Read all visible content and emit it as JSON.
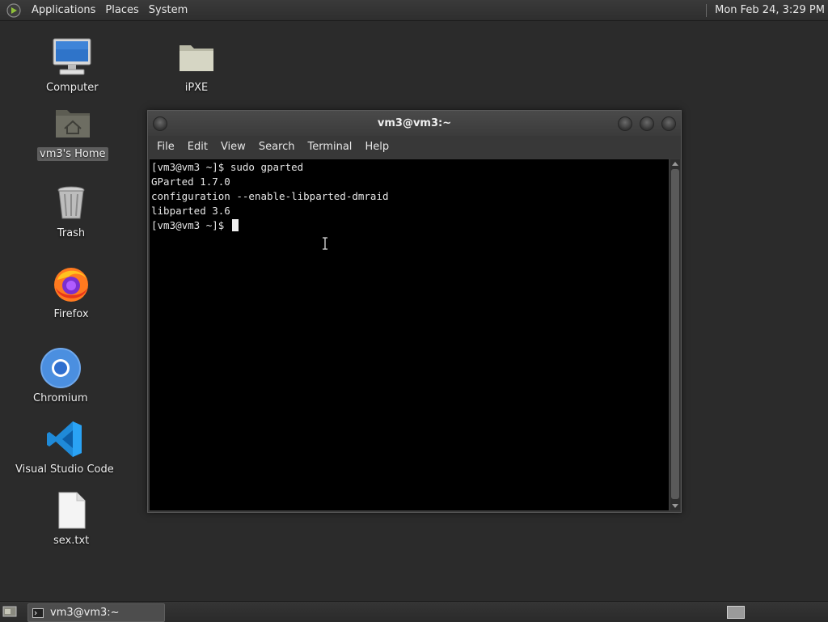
{
  "top_panel": {
    "menus": [
      "Applications",
      "Places",
      "System"
    ],
    "clock": "Mon Feb 24,  3:29 PM"
  },
  "desktop": {
    "icons": {
      "computer": "Computer",
      "ipxe": "iPXE",
      "home": "vm3's Home",
      "trash": "Trash",
      "firefox": "Firefox",
      "chromium": "Chromium",
      "vscode": "Visual Studio Code",
      "textfile": "sex.txt"
    }
  },
  "terminal": {
    "title": "vm3@vm3:~",
    "menu": [
      "File",
      "Edit",
      "View",
      "Search",
      "Terminal",
      "Help"
    ],
    "lines": [
      "[vm3@vm3 ~]$ sudo gparted",
      "GParted 1.7.0",
      "configuration --enable-libparted-dmraid",
      "libparted 3.6",
      "[vm3@vm3 ~]$ "
    ]
  },
  "bottom_panel": {
    "task_label": "vm3@vm3:~"
  },
  "colors": {
    "desktop_bg": "#2b2b2b",
    "terminal_bg": "#000000",
    "panel_bg": "#333333"
  }
}
